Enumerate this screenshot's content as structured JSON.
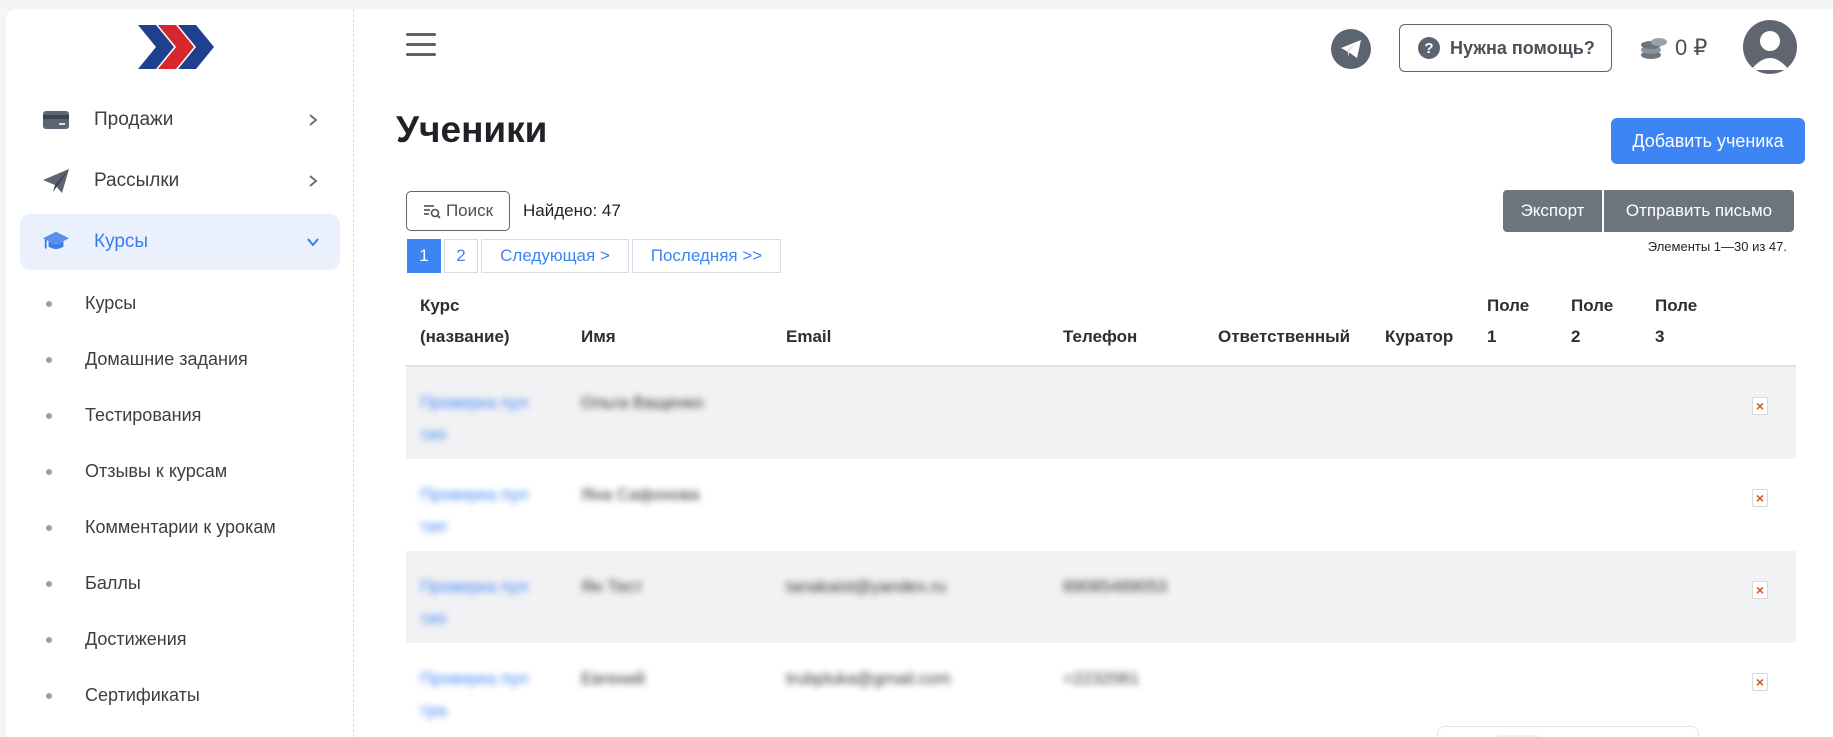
{
  "sidebar": {
    "items": [
      {
        "label": "Продажи",
        "icon": "credit-card-icon"
      },
      {
        "label": "Рассылки",
        "icon": "paper-plane-icon"
      },
      {
        "label": "Курсы",
        "icon": "graduation-cap-icon"
      }
    ],
    "sub_items": [
      "Курсы",
      "Домашние задания",
      "Тестирования",
      "Отзывы к курсам",
      "Комментарии к урокам",
      "Баллы",
      "Достижения",
      "Сертификаты"
    ]
  },
  "header": {
    "help_label": "Нужна помощь?",
    "balance": "0 ₽"
  },
  "page": {
    "title": "Ученики",
    "add_button": "Добавить ученика"
  },
  "toolbar": {
    "search_label": "Поиск",
    "found": "Найдено: 47",
    "export_label": "Экспорт",
    "send_label": "Отправить письмо",
    "range": "Элементы 1—30 из 47."
  },
  "pagination": {
    "pages": [
      "1",
      "2"
    ],
    "next": "Следующая >",
    "last": "Последняя >>"
  },
  "table": {
    "headers": {
      "course": [
        "Курс",
        "(название)"
      ],
      "name": "Имя",
      "email": "Email",
      "phone": "Телефон",
      "responsible": "Ответственный",
      "curator": "Куратор",
      "field1": [
        "Поле",
        "1"
      ],
      "field2": [
        "Поле",
        "2"
      ],
      "field3": [
        "Поле",
        "3"
      ]
    },
    "rows": [
      {
        "course": [
          "Проверка пул",
          "тип"
        ],
        "name": "Ольга Ващенко",
        "email": "",
        "phone": ""
      },
      {
        "course": [
          "Проверка пул",
          "тип"
        ],
        "name": "Яна Сафонова",
        "email": "",
        "phone": ""
      },
      {
        "course": [
          "Проверка пул",
          "тип"
        ],
        "name": "Ян Тест",
        "email": "tanakaist@yandex.ru",
        "phone": "89085489053"
      },
      {
        "course": [
          "Проверка пул",
          "тра"
        ],
        "name": "Евгений",
        "email": "trubpluka@gmail.com",
        "phone": "+2232061"
      }
    ],
    "delete_icon": "delete-icon"
  },
  "colors": {
    "accent": "#3d85f5",
    "secondary": "#6c757d",
    "active_bg": "#eaf1fd"
  }
}
